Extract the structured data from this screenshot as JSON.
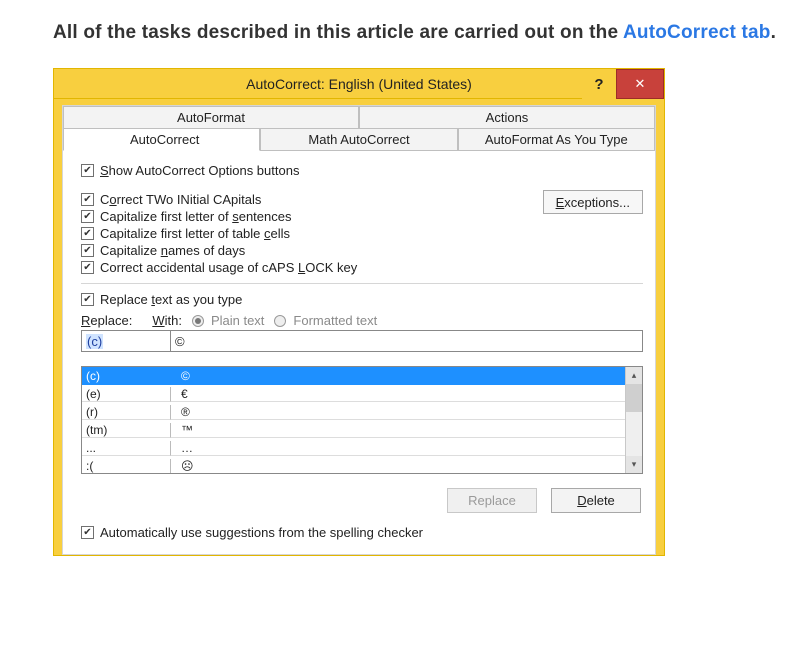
{
  "intro": {
    "prefix": "All of the tasks described in this article are carried out on the ",
    "link": "AutoCorrect tab"
  },
  "dialog": {
    "title": "AutoCorrect: English (United States)",
    "help_label": "?",
    "close_label": "✕",
    "tabs_top": [
      "AutoFormat",
      "Actions"
    ],
    "tabs_bottom": [
      "AutoCorrect",
      "Math AutoCorrect",
      "AutoFormat As You Type"
    ],
    "active_tab": "AutoCorrect",
    "options": {
      "show_buttons": "Show AutoCorrect Options buttons",
      "two_initial": "Correct TWo INitial CApitals",
      "first_sentence": "Capitalize first letter of sentences",
      "first_cell": "Capitalize first letter of table cells",
      "names_days": "Capitalize names of days",
      "caps_lock": "Correct accidental usage of cAPS LOCK key"
    },
    "exceptions_label": "Exceptions...",
    "replace_section": {
      "replace_as_type": "Replace text as you type",
      "replace_label": "Replace:",
      "with_label": "With:",
      "plain_text": "Plain text",
      "formatted_text": "Formatted text",
      "replace_value": "(c)",
      "with_value": "©",
      "list": [
        {
          "a": "(c)",
          "b": "©"
        },
        {
          "a": "(e)",
          "b": "€"
        },
        {
          "a": "(r)",
          "b": "®"
        },
        {
          "a": "(tm)",
          "b": "™"
        },
        {
          "a": "...",
          "b": "…"
        },
        {
          "a": ":(",
          "b": "☹"
        }
      ]
    },
    "buttons": {
      "replace": "Replace",
      "delete": "Delete"
    },
    "auto_suggest": "Automatically use suggestions from the spelling checker"
  }
}
